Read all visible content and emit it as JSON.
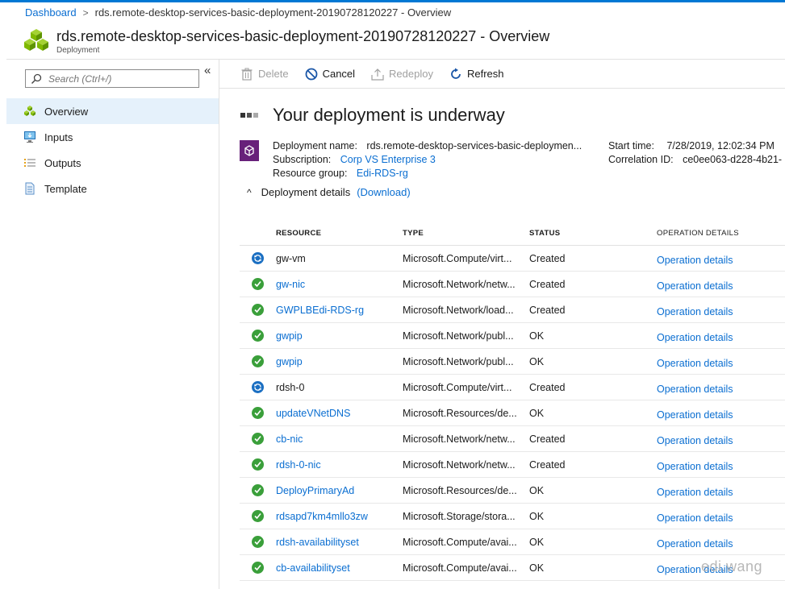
{
  "breadcrumb": {
    "root": "Dashboard",
    "separator": ">",
    "current": "rds.remote-desktop-services-basic-deployment-20190728120227 - Overview"
  },
  "header": {
    "title": "rds.remote-desktop-services-basic-deployment-20190728120227 - Overview",
    "subtitle": "Deployment",
    "icon": "deployment-cubes-icon"
  },
  "sidebar": {
    "collapse_label": "«",
    "search_placeholder": "Search (Ctrl+/)",
    "items": [
      {
        "label": "Overview",
        "icon": "overview-cubes-icon",
        "active": true
      },
      {
        "label": "Inputs",
        "icon": "inputs-monitor-icon",
        "active": false
      },
      {
        "label": "Outputs",
        "icon": "outputs-list-icon",
        "active": false
      },
      {
        "label": "Template",
        "icon": "template-document-icon",
        "active": false
      }
    ]
  },
  "toolbar": {
    "delete_label": "Delete",
    "cancel_label": "Cancel",
    "redeploy_label": "Redeploy",
    "refresh_label": "Refresh"
  },
  "status": {
    "title": "Your deployment is underway"
  },
  "info": {
    "deployment_name_label": "Deployment name:",
    "deployment_name_value": "rds.remote-desktop-services-basic-deploymen...",
    "subscription_label": "Subscription:",
    "subscription_value": "Corp VS Enterprise 3",
    "resource_group_label": "Resource group:",
    "resource_group_value": "Edi-RDS-rg",
    "start_time_label": "Start time:",
    "start_time_value": "7/28/2019, 12:02:34 PM",
    "correlation_label": "Correlation ID:",
    "correlation_value": "ce0ee063-d228-4b21-"
  },
  "details": {
    "toggle_label": "Deployment details",
    "download_label": "(Download)",
    "chevron": "^"
  },
  "table": {
    "headers": {
      "resource": "RESOURCE",
      "type": "TYPE",
      "status": "STATUS",
      "operation": "OPERATION DETAILS"
    },
    "rows": [
      {
        "icon": "in-progress",
        "resource": "gw-vm",
        "link": false,
        "type": "Microsoft.Compute/virt...",
        "status": "Created",
        "operation": "Operation details"
      },
      {
        "icon": "succeeded",
        "resource": "gw-nic",
        "link": true,
        "type": "Microsoft.Network/netw...",
        "status": "Created",
        "operation": "Operation details"
      },
      {
        "icon": "succeeded",
        "resource": "GWPLBEdi-RDS-rg",
        "link": true,
        "type": "Microsoft.Network/load...",
        "status": "Created",
        "operation": "Operation details"
      },
      {
        "icon": "succeeded",
        "resource": "gwpip",
        "link": true,
        "type": "Microsoft.Network/publ...",
        "status": "OK",
        "operation": "Operation details"
      },
      {
        "icon": "succeeded",
        "resource": "gwpip",
        "link": true,
        "type": "Microsoft.Network/publ...",
        "status": "OK",
        "operation": "Operation details"
      },
      {
        "icon": "in-progress",
        "resource": "rdsh-0",
        "link": false,
        "type": "Microsoft.Compute/virt...",
        "status": "Created",
        "operation": "Operation details"
      },
      {
        "icon": "succeeded",
        "resource": "updateVNetDNS",
        "link": true,
        "type": "Microsoft.Resources/de...",
        "status": "OK",
        "operation": "Operation details"
      },
      {
        "icon": "succeeded",
        "resource": "cb-nic",
        "link": true,
        "type": "Microsoft.Network/netw...",
        "status": "Created",
        "operation": "Operation details"
      },
      {
        "icon": "succeeded",
        "resource": "rdsh-0-nic",
        "link": true,
        "type": "Microsoft.Network/netw...",
        "status": "Created",
        "operation": "Operation details"
      },
      {
        "icon": "succeeded",
        "resource": "DeployPrimaryAd",
        "link": true,
        "type": "Microsoft.Resources/de...",
        "status": "OK",
        "operation": "Operation details"
      },
      {
        "icon": "succeeded",
        "resource": "rdsapd7km4mllo3zw",
        "link": true,
        "type": "Microsoft.Storage/stora...",
        "status": "OK",
        "operation": "Operation details"
      },
      {
        "icon": "succeeded",
        "resource": "rdsh-availabilityset",
        "link": true,
        "type": "Microsoft.Compute/avai...",
        "status": "OK",
        "operation": "Operation details"
      },
      {
        "icon": "succeeded",
        "resource": "cb-availabilityset",
        "link": true,
        "type": "Microsoft.Compute/avai...",
        "status": "OK",
        "operation": "Operation details"
      }
    ]
  },
  "watermark": "edi.wang",
  "colors": {
    "accent": "#0078d4",
    "link": "#0a6ed1",
    "success": "#3a9f3a",
    "progress": "#1b6fc2",
    "badge": "#68217a",
    "active_bg": "#e5f1fb"
  }
}
